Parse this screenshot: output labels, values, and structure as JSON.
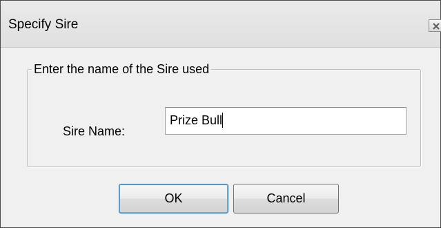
{
  "window": {
    "title": "Specify Sire",
    "close_icon": "close-icon"
  },
  "group": {
    "legend": "Enter the name of the Sire used"
  },
  "form": {
    "sire_label": "Sire Name:",
    "sire_value": "Prize Bull"
  },
  "buttons": {
    "ok_label": "OK",
    "cancel_label": "Cancel"
  },
  "colors": {
    "dialog_bg": "#f0f0f0",
    "default_button_border": "#3c7fb1"
  }
}
